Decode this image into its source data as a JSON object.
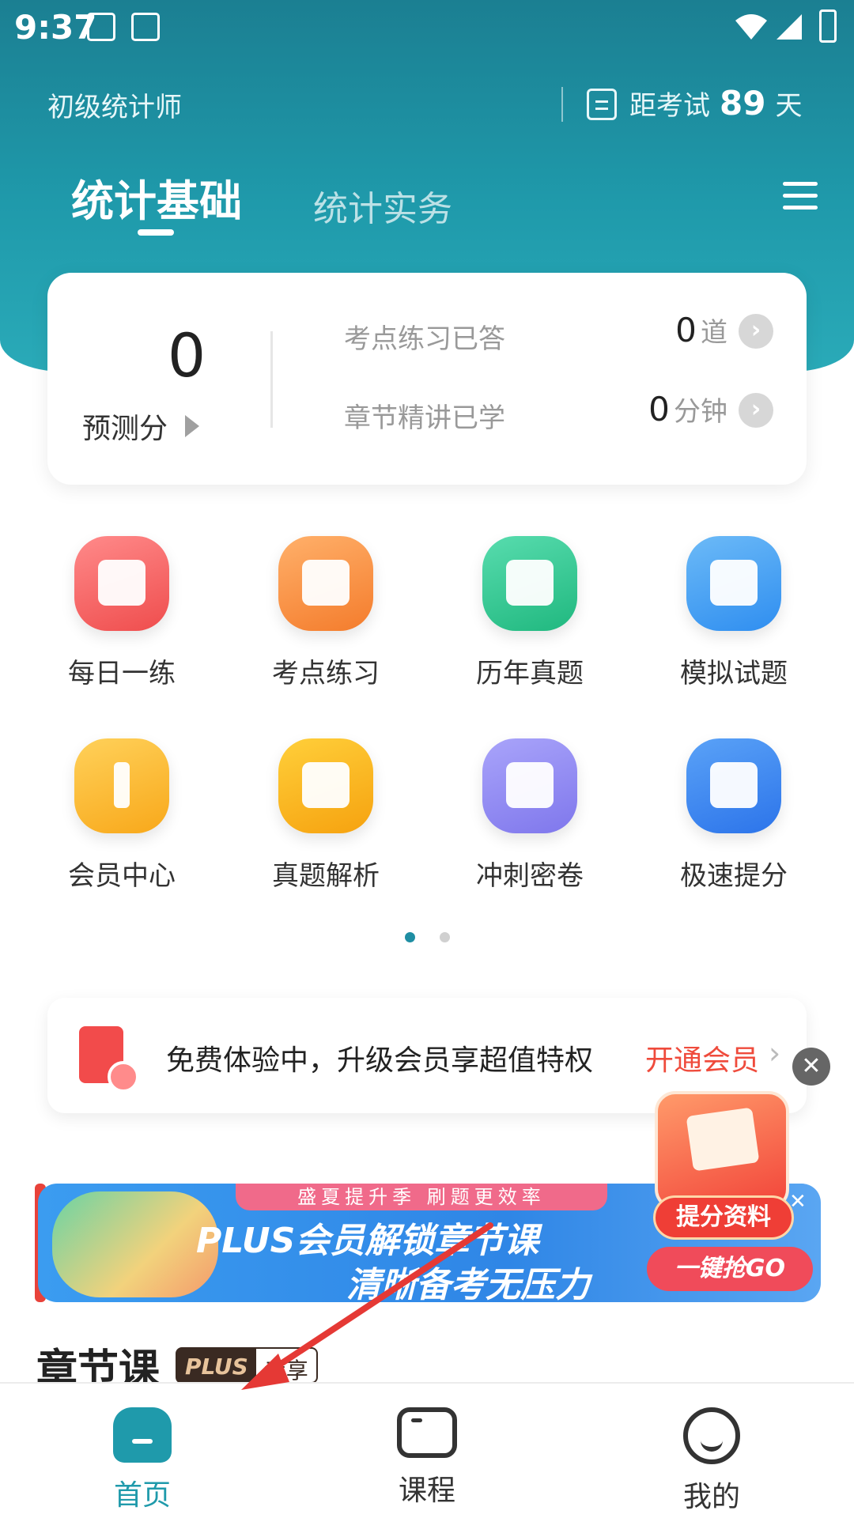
{
  "status_bar": {
    "time": "9:37"
  },
  "header": {
    "exam_name": "初级统计师",
    "countdown_prefix": "距考试",
    "countdown_days": "89",
    "countdown_suffix": "天",
    "tabs": [
      {
        "label": "统计基础",
        "active": true
      },
      {
        "label": "统计实务",
        "active": false
      }
    ]
  },
  "stats": {
    "score": "0",
    "score_label": "预测分",
    "rows": [
      {
        "label": "考点练习已答",
        "value": "0",
        "unit": "道"
      },
      {
        "label": "章节精讲已学",
        "value": "0",
        "unit": "分钟"
      }
    ]
  },
  "grid": [
    {
      "label": "每日一练",
      "icon": "calendar-check-icon",
      "color": "#f35f5f"
    },
    {
      "label": "考点练习",
      "icon": "lightning-doc-icon",
      "color": "#f88b3a"
    },
    {
      "label": "历年真题",
      "icon": "document-icon",
      "color": "#2ec590"
    },
    {
      "label": "模拟试题",
      "icon": "monitor-chart-icon",
      "color": "#3a9bf2"
    },
    {
      "label": "会员中心",
      "icon": "crown-icon",
      "color": "#f9b322"
    },
    {
      "label": "真题解析",
      "icon": "edit-doc-icon",
      "color": "#f9a915"
    },
    {
      "label": "冲刺密卷",
      "icon": "book-icon",
      "color": "#8d86f2"
    },
    {
      "label": "极速提分",
      "icon": "image-plus-icon",
      "color": "#3b82f0"
    }
  ],
  "pagination": {
    "total": 2,
    "active": 0
  },
  "promo": {
    "text": "免费体验中，升级会员享超值特权",
    "cta": "开通会员"
  },
  "banner": {
    "strip": "盛夏提升季 刷题更效率",
    "line1": "PLUS会员解锁章节课",
    "line2": "清晰备考无压力",
    "cta": "一键抢GO"
  },
  "float_ad": {
    "label": "提分资料"
  },
  "section": {
    "title": "章节课",
    "badge_plus": "PLUS",
    "badge_text": "专享"
  },
  "bottom_nav": [
    {
      "label": "首页",
      "active": true
    },
    {
      "label": "课程",
      "active": false
    },
    {
      "label": "我的",
      "active": false
    }
  ],
  "colors": {
    "primary": "#1f9aab",
    "accent_red": "#ef4b3c",
    "arrow": "#e53935"
  }
}
